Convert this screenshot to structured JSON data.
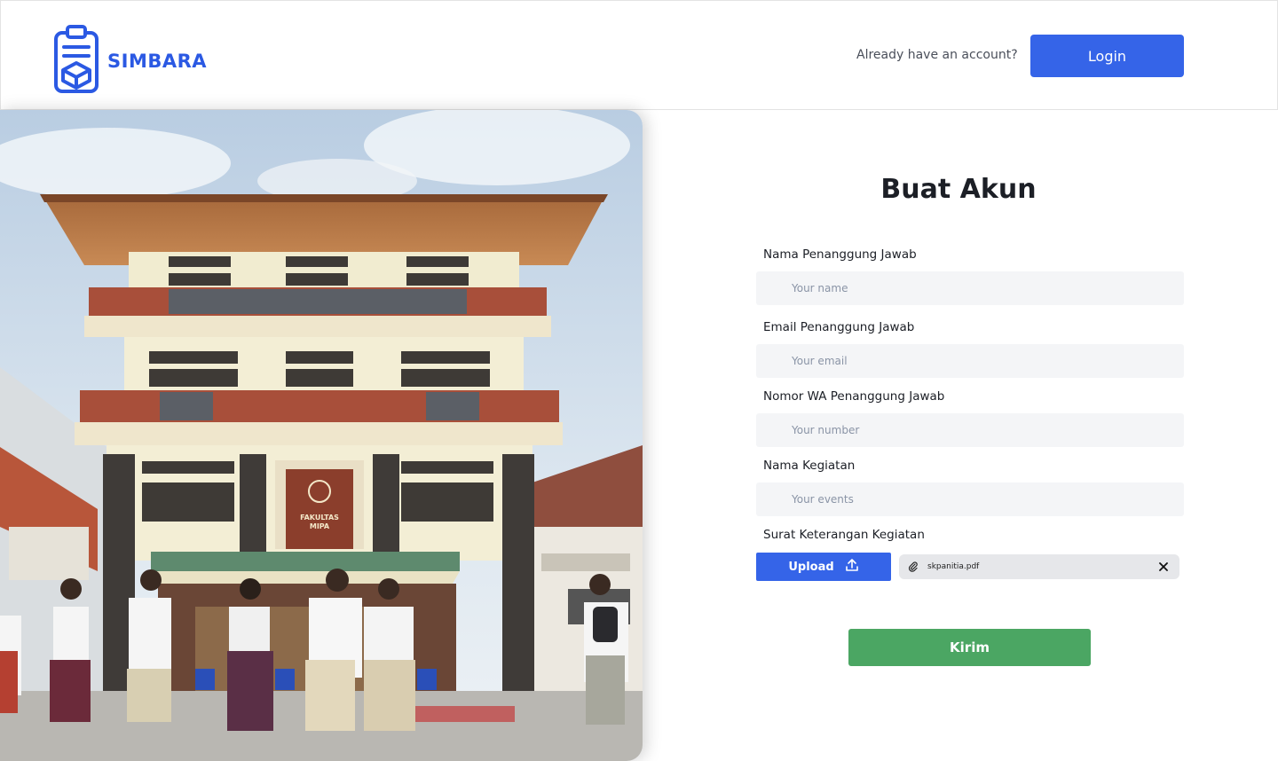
{
  "header": {
    "brand": "SIMBARA",
    "account_question": "Already have an account?",
    "login_label": "Login"
  },
  "photo": {
    "sign_line1": "FAKULTAS",
    "sign_line2": "MIPA"
  },
  "form": {
    "title": "Buat Akun",
    "fields": [
      {
        "label": "Nama Penanggung Jawab",
        "placeholder": "Your name"
      },
      {
        "label": "Email Penanggung Jawab",
        "placeholder": "Your email"
      },
      {
        "label": "Nomor WA Penanggung Jawab",
        "placeholder": "Your number"
      },
      {
        "label": "Nama Kegiatan",
        "placeholder": "Your events"
      }
    ],
    "upload": {
      "label": "Surat Keterangan Kegiatan",
      "button_label": "Upload",
      "file_name": "skpanitia.pdf"
    },
    "submit_label": "Kirim"
  },
  "colors": {
    "primary": "#3564e8",
    "brand": "#2b59e3",
    "submit": "#4ba663",
    "input_bg": "#f4f5f7"
  }
}
